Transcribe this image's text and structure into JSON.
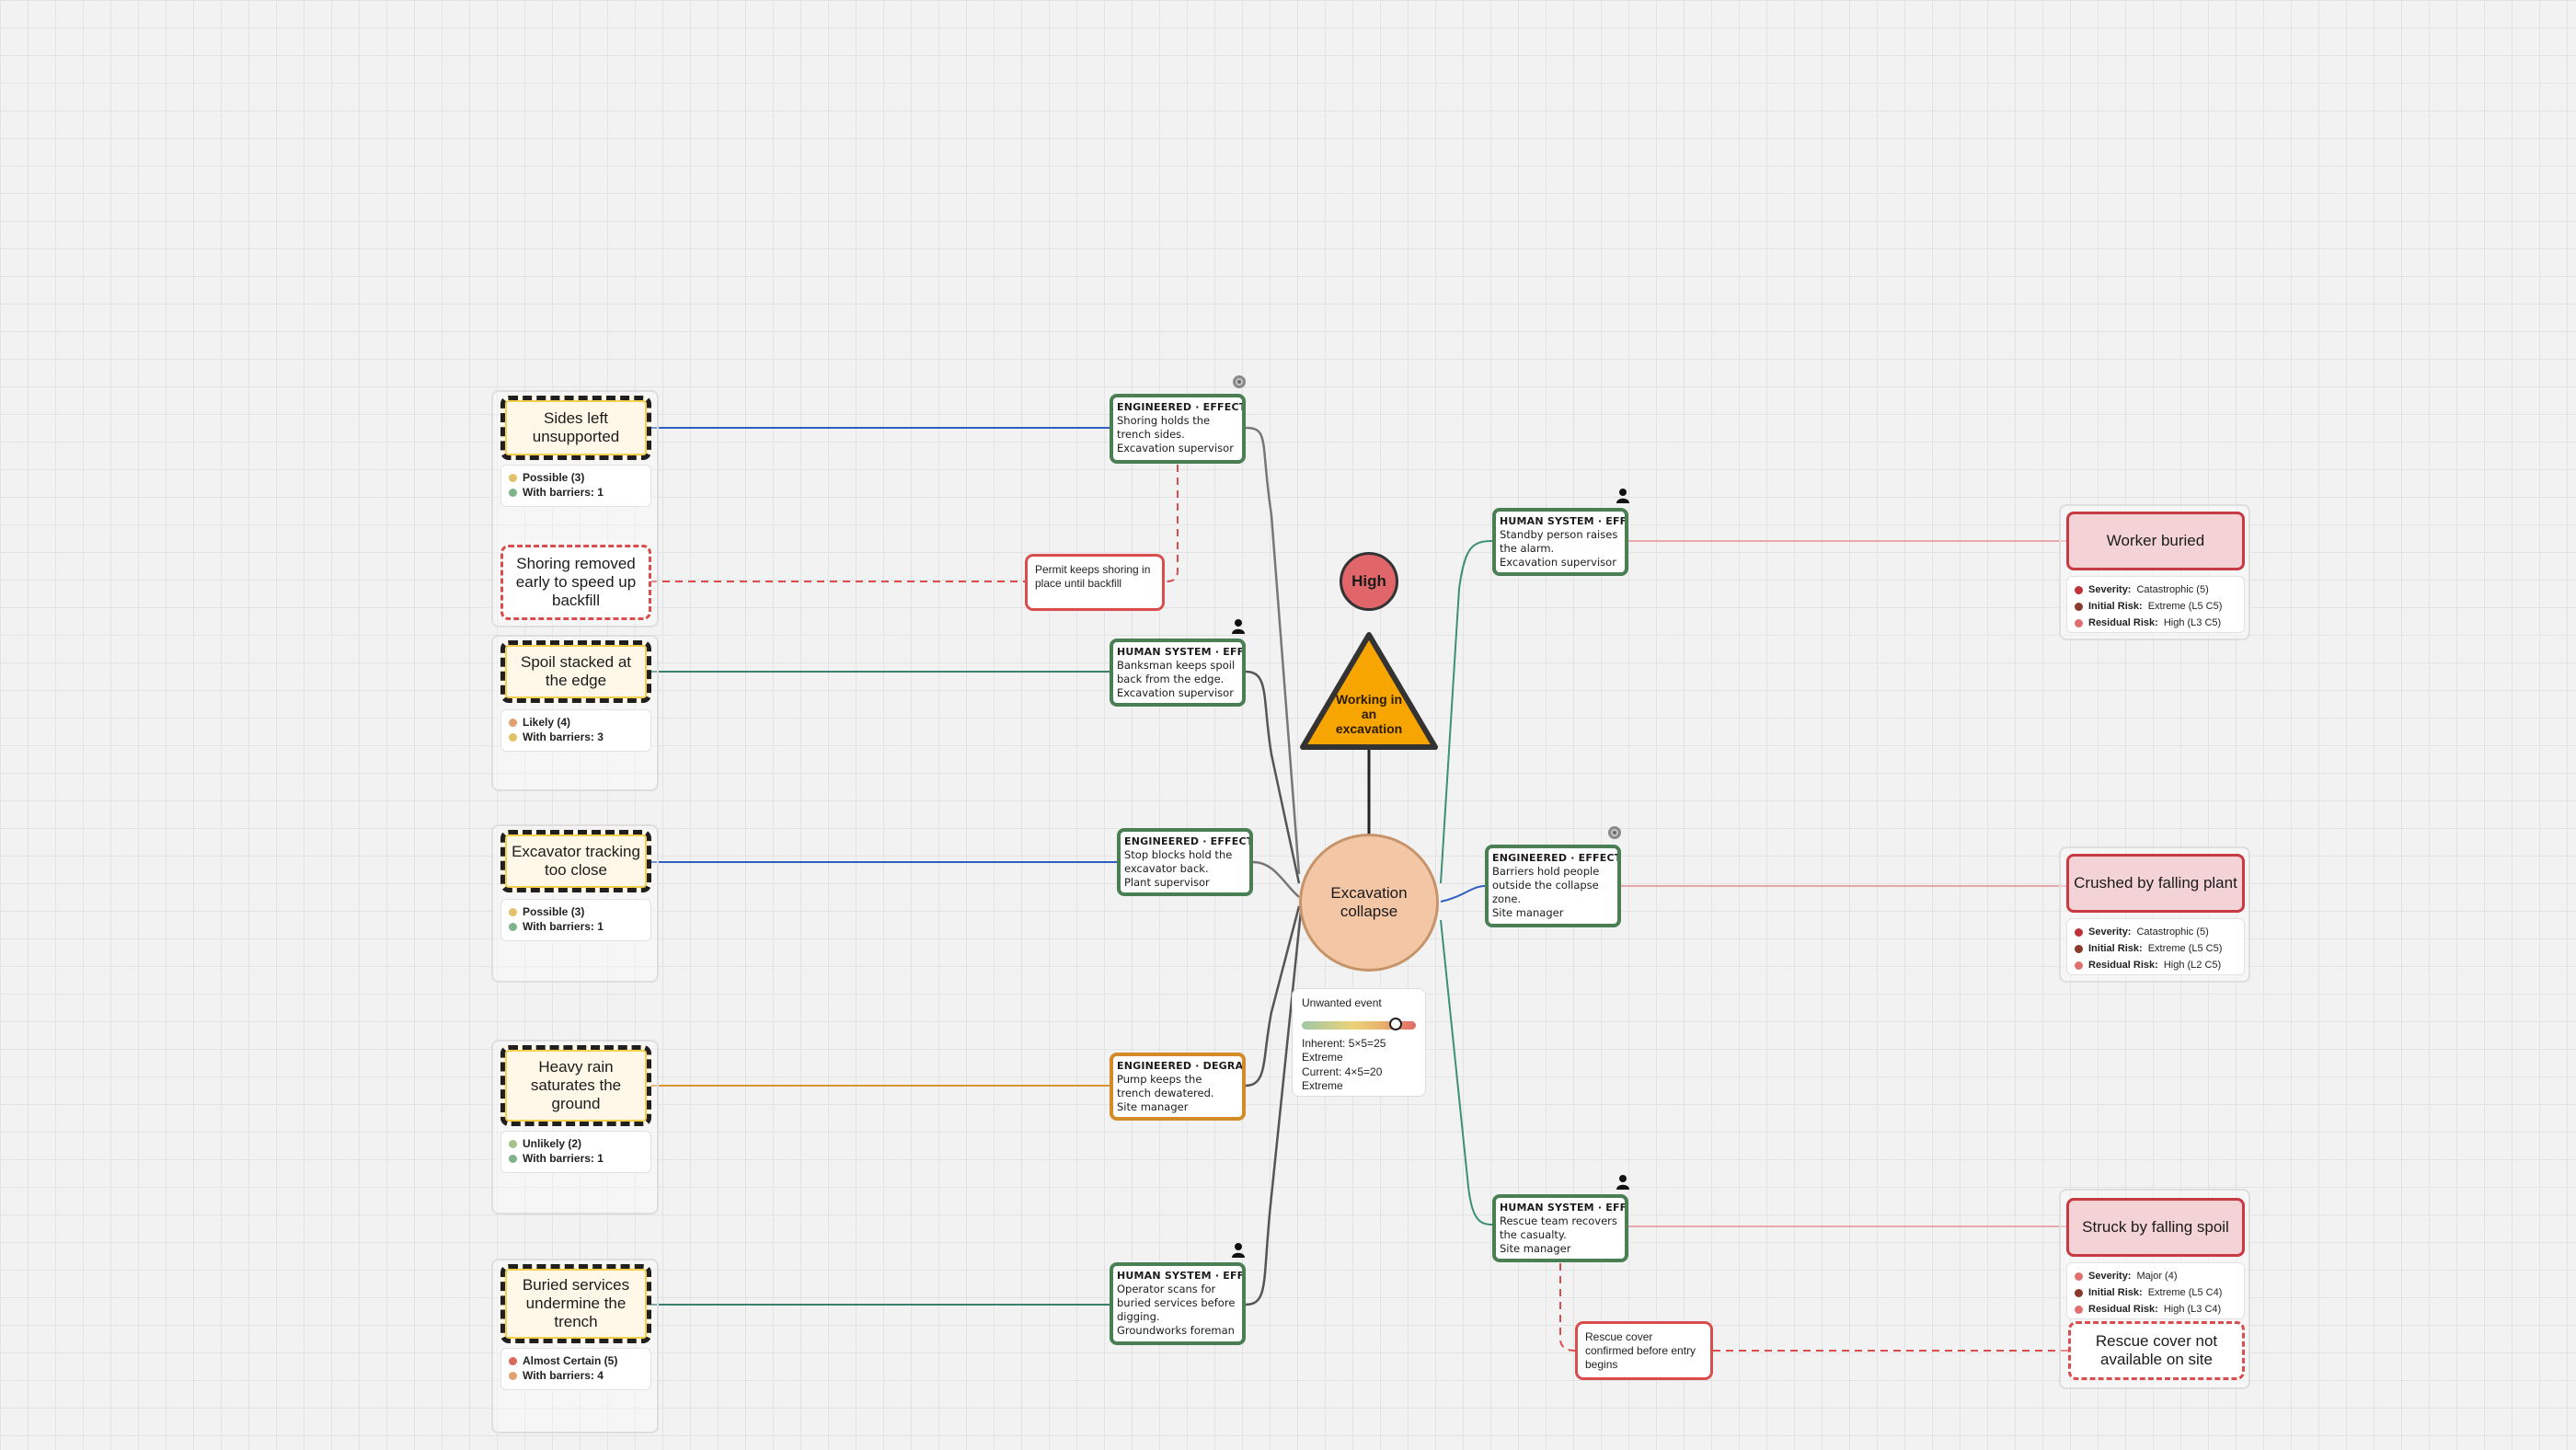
{
  "colors": {
    "threat_wire": "#2f5fbf",
    "human_wire": "#3d7f6f",
    "degraded_wire": "#d9952f",
    "escalation": "#d94d4d",
    "consequence_wire": "#e6a9ab",
    "barrier_effective": "#4a7f53",
    "barrier_degraded": "#d48a26",
    "hazard": "#f7a500"
  },
  "hazard": {
    "label": "Working in an excavation",
    "icon": "warning-triangle-icon"
  },
  "risk_badge": {
    "label": "High"
  },
  "top_event": {
    "label": "Excavation collapse"
  },
  "risk_card": {
    "title": "Unwanted event",
    "gauge_level": 0.82,
    "inherent_line": "Inherent: 5×5=25",
    "inherent_level": "Extreme",
    "current_line": "Current: 4×5=20",
    "current_level": "Extreme"
  },
  "threats": [
    {
      "label": "Sides left unsupported",
      "likelihood": "Possible (3)",
      "likelihood_color": "#e3c267",
      "barriers": "With barriers: 1",
      "barriers_color": "#7fb38a"
    },
    {
      "label": "Spoil stacked at the edge",
      "likelihood": "Likely (4)",
      "likelihood_color": "#e0a070",
      "barriers": "With barriers: 3",
      "barriers_color": "#e3c267"
    },
    {
      "label": "Excavator tracking too close",
      "likelihood": "Possible (3)",
      "likelihood_color": "#e3c267",
      "barriers": "With barriers: 1",
      "barriers_color": "#7fb38a"
    },
    {
      "label": "Heavy rain saturates the ground",
      "likelihood": "Unlikely (2)",
      "likelihood_color": "#a5c28a",
      "barriers": "With barriers: 1",
      "barriers_color": "#7fb38a"
    },
    {
      "label": "Buried services undermine the trench",
      "likelihood": "Almost Certain (5)",
      "likelihood_color": "#d96a5a",
      "barriers": "With barriers: 4",
      "barriers_color": "#e0a070"
    }
  ],
  "escalation_left": {
    "label": "Shoring removed early to speed up backfill",
    "barrier": "Permit keeps shoring in place until backfill"
  },
  "escalation_right": {
    "label": "Rescue cover not available on site",
    "barrier": "Rescue cover confirmed before entry begins"
  },
  "prevention_barriers": [
    {
      "type": "ENGINEERED · EFFECTIVE",
      "text": "Shoring holds the trench sides.",
      "owner": "Excavation supervisor",
      "icon": "gear-icon"
    },
    {
      "type": "HUMAN SYSTEM · EFFECTIVE",
      "text": "Banksman keeps spoil back from the edge.",
      "owner": "Excavation supervisor",
      "icon": "person-icon"
    },
    {
      "type": "ENGINEERED · EFFECTIVE",
      "text": "Stop blocks hold the excavator back.",
      "owner": "Plant supervisor",
      "icon": ""
    },
    {
      "type": "ENGINEERED · DEGRADED",
      "text": "Pump keeps the trench dewatered.",
      "owner": "Site manager",
      "icon": ""
    },
    {
      "type": "HUMAN SYSTEM · EFFECTIVE",
      "text": "Operator scans for buried services before digging.",
      "owner": "Groundworks foreman",
      "icon": "person-icon"
    }
  ],
  "mitigation_barriers": [
    {
      "type": "HUMAN SYSTEM · EFFECTIVE",
      "text": "Standby person raises the alarm.",
      "owner": "Excavation supervisor",
      "icon": "person-icon"
    },
    {
      "type": "ENGINEERED · EFFECTIVE",
      "text": "Barriers hold people outside the collapse zone.",
      "owner": "Site manager",
      "icon": "gear-icon"
    },
    {
      "type": "HUMAN SYSTEM · EFFECTIVE",
      "text": "Rescue team recovers the casualty.",
      "owner": "Site manager",
      "icon": "person-icon"
    }
  ],
  "consequences": [
    {
      "label": "Worker buried",
      "severity_label": "Severity:",
      "severity": "Catastrophic (5)",
      "initial_label": "Initial Risk:",
      "initial": "Extreme (L5 C5)",
      "residual_label": "Residual Risk:",
      "residual": "High (L3 C5)"
    },
    {
      "label": "Crushed by falling plant",
      "severity_label": "Severity:",
      "severity": "Catastrophic (5)",
      "initial_label": "Initial Risk:",
      "initial": "Extreme (L5 C5)",
      "residual_label": "Residual Risk:",
      "residual": "High (L2 C5)"
    },
    {
      "label": "Struck by falling spoil",
      "severity_label": "Severity:",
      "severity": "Major (4)",
      "initial_label": "Initial Risk:",
      "initial": "Extreme (L5 C4)",
      "residual_label": "Residual Risk:",
      "residual": "High (L3 C4)"
    }
  ]
}
